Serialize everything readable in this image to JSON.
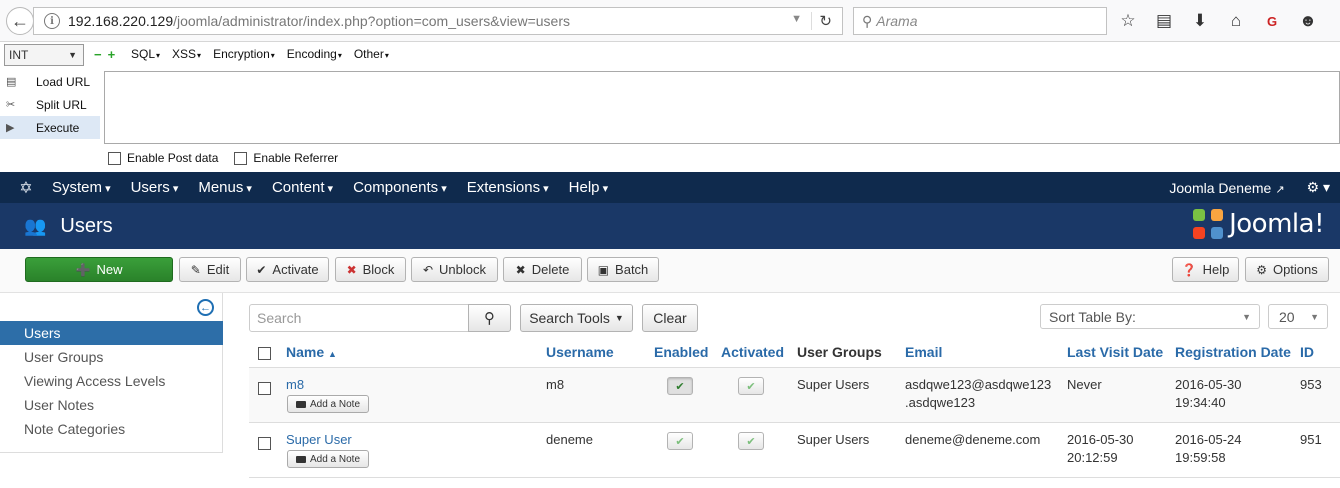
{
  "browser": {
    "url_host": "192.168.220.129",
    "url_path": "/joomla/administrator/index.php?option=com_users&view=users",
    "search_placeholder": "Arama"
  },
  "hackbar": {
    "select_value": "INT",
    "menus": [
      "SQL",
      "XSS",
      "Encryption",
      "Encoding",
      "Other"
    ],
    "actions": [
      "Load URL",
      "Split URL",
      "Execute"
    ],
    "check_post": "Enable Post data",
    "check_referrer": "Enable Referrer"
  },
  "nav": {
    "items": [
      "System",
      "Users",
      "Menus",
      "Content",
      "Components",
      "Extensions",
      "Help"
    ],
    "site_name": "Joomla Deneme"
  },
  "header": {
    "title": "Users",
    "brand": "Joomla!"
  },
  "toolbar": {
    "new": "New",
    "edit": "Edit",
    "activate": "Activate",
    "block": "Block",
    "unblock": "Unblock",
    "delete": "Delete",
    "batch": "Batch",
    "help": "Help",
    "options": "Options"
  },
  "sidebar": {
    "items": [
      "Users",
      "User Groups",
      "Viewing Access Levels",
      "User Notes",
      "Note Categories"
    ]
  },
  "filters": {
    "search_placeholder": "Search",
    "search_tools": "Search Tools",
    "clear": "Clear",
    "sort_by": "Sort Table By:",
    "limit": "20"
  },
  "table": {
    "headers": {
      "name": "Name",
      "username": "Username",
      "enabled": "Enabled",
      "activated": "Activated",
      "groups": "User Groups",
      "email": "Email",
      "last_visit": "Last Visit Date",
      "registration": "Registration Date",
      "id": "ID"
    },
    "note_label": "Add a Note",
    "rows": [
      {
        "name": "m8",
        "username": "m8",
        "groups": "Super Users",
        "email_line1": "asdqwe123@asdqwe123",
        "email_line2": ".asdqwe123",
        "last_visit_line1": "Never",
        "last_visit_line2": "",
        "reg_line1": "2016-05-30",
        "reg_line2": "19:34:40",
        "id": "953"
      },
      {
        "name": "Super User",
        "username": "deneme",
        "groups": "Super Users",
        "email_line1": "deneme@deneme.com",
        "email_line2": "",
        "last_visit_line1": "2016-05-30",
        "last_visit_line2": "20:12:59",
        "reg_line1": "2016-05-24",
        "reg_line2": "19:59:58",
        "id": "951"
      }
    ]
  }
}
